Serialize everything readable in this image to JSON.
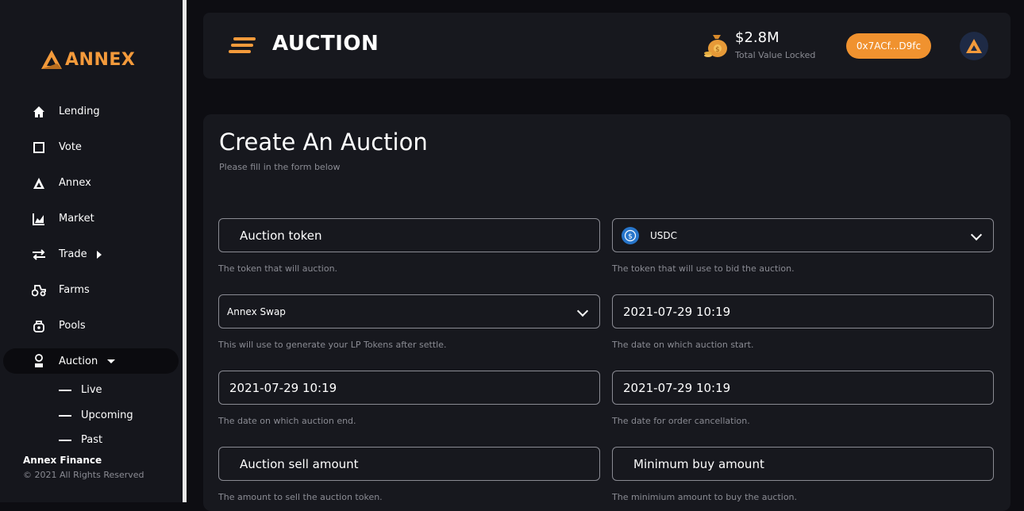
{
  "brand": {
    "name": "ANNEX",
    "accent": "#f39a3b"
  },
  "sidebar": {
    "items": [
      {
        "label": "Lending",
        "icon": "home-icon"
      },
      {
        "label": "Vote",
        "icon": "square-icon"
      },
      {
        "label": "Annex",
        "icon": "annex-logo-icon"
      },
      {
        "label": "Market",
        "icon": "chart-icon"
      },
      {
        "label": "Trade",
        "icon": "swap-icon"
      },
      {
        "label": "Farms",
        "icon": "tractor-icon"
      },
      {
        "label": "Pools",
        "icon": "pool-icon"
      },
      {
        "label": "Auction",
        "icon": "auction-icon"
      }
    ],
    "auction_sub": [
      "Live",
      "Upcoming",
      "Past"
    ],
    "footer_title": "Annex Finance",
    "footer_copy": "© 2021 All Rights Reserved"
  },
  "header": {
    "title": "AUCTION",
    "tvl_value": "$2.8M",
    "tvl_label": "Total Value Locked",
    "wallet": "0x7ACf...D9fc"
  },
  "form": {
    "title": "Create An Auction",
    "subtitle": "Please fill in the form below",
    "auction_token": {
      "placeholder": "Auction token",
      "hint": "The token that will auction."
    },
    "bid_token": {
      "value": "USDC",
      "hint": "The token that will use to bid the auction."
    },
    "lp_router": {
      "value": "Annex Swap",
      "hint": "This will use to generate your LP Tokens after settle."
    },
    "start_date": {
      "value": "2021-07-29 10:19",
      "hint": "The date on which auction start."
    },
    "end_date": {
      "value": "2021-07-29 10:19",
      "hint": "The date on which auction end."
    },
    "cancel_date": {
      "value": "2021-07-29 10:19",
      "hint": "The date for order cancellation."
    },
    "sell_amount": {
      "placeholder": "Auction sell amount",
      "hint": "The amount to sell the auction token."
    },
    "min_buy": {
      "placeholder": "Minimum buy amount",
      "hint": "The minimium amount to buy the auction."
    }
  }
}
